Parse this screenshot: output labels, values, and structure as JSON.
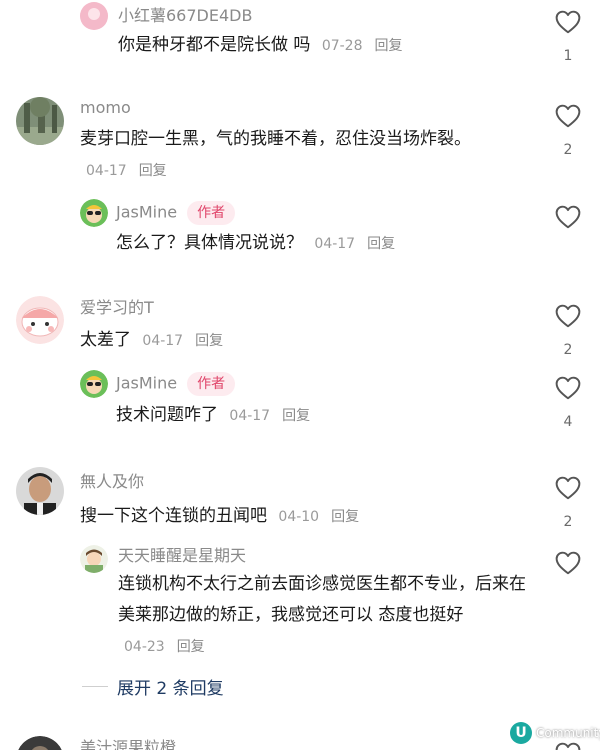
{
  "comments": [
    {
      "username": "小红薯667DE4DB",
      "text": "你是种牙都不是院长做 吗",
      "date": "07-28",
      "reply": "回复",
      "likes": "1"
    },
    {
      "username": "momo",
      "text": "麦芽口腔一生黑，气的我睡不着，忍住没当场炸裂。",
      "date": "04-17",
      "reply": "回复",
      "likes": "2"
    },
    {
      "username": "JasMine",
      "badge": "作者",
      "text": "怎么了？具体情况说说？",
      "date": "04-17",
      "reply": "回复",
      "likes": ""
    },
    {
      "username": "爱学习的T",
      "text": "太差了",
      "date": "04-17",
      "reply": "回复",
      "likes": "2"
    },
    {
      "username": "JasMine",
      "badge": "作者",
      "text": "技术问题咋了",
      "date": "04-17",
      "reply": "回复",
      "likes": "4"
    },
    {
      "username": "無人及你",
      "text": "搜一下这个连锁的丑闻吧",
      "date": "04-10",
      "reply": "回复",
      "likes": "2"
    },
    {
      "username": "天天睡醒是星期天",
      "text": "连锁机构不太行之前去面诊感觉医生都不专业，后来在美莱那边做的矫正，我感觉还可以 态度也挺好",
      "date": "04-23",
      "reply": "回复",
      "likes": ""
    },
    {
      "username": "美汁源果粒橙",
      "text": "",
      "date": "",
      "reply": "",
      "likes": ""
    }
  ],
  "expand_replies": "展开 2 条回复",
  "watermark": "Community"
}
